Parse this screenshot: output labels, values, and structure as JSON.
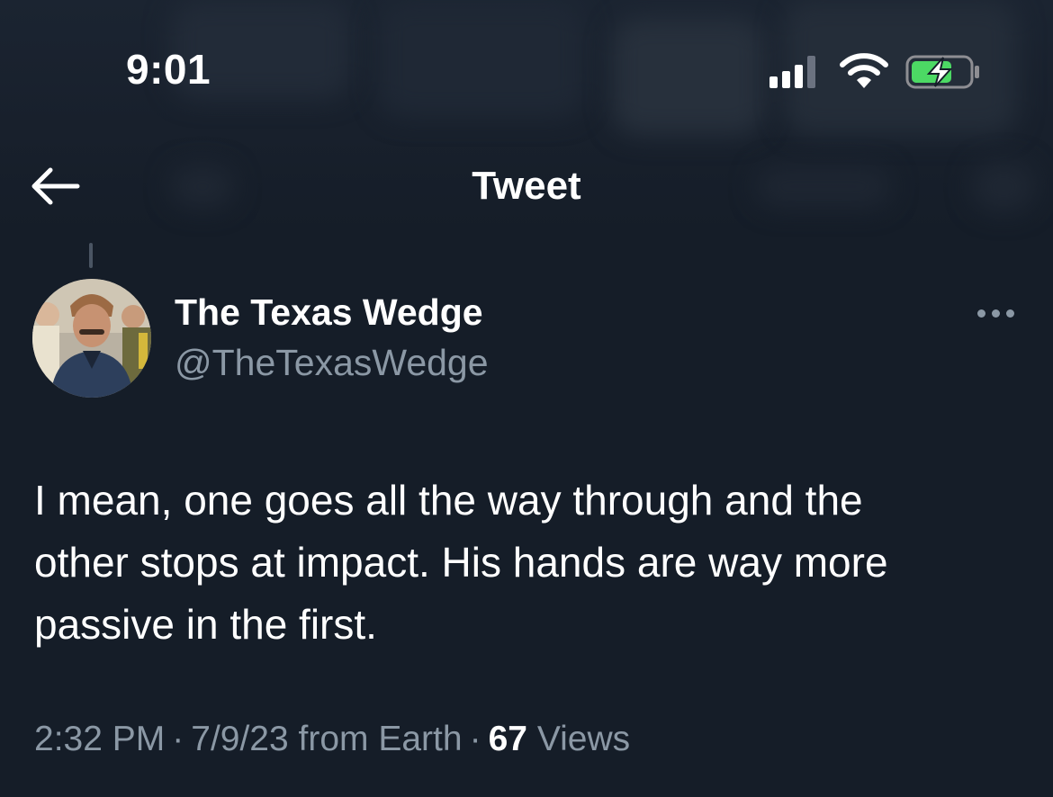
{
  "status_bar": {
    "time": "9:01",
    "signal_icon": "cellular-signal-icon",
    "wifi_icon": "wifi-icon",
    "battery_icon": "battery-charging-icon",
    "battery_color": "#4cd964"
  },
  "nav": {
    "back_icon": "arrow-left-icon",
    "title": "Tweet"
  },
  "tweet": {
    "author": {
      "display_name": "The Texas Wedge",
      "handle": "@TheTexasWedge",
      "avatar": "avatar-photo"
    },
    "more_icon": "more-horizontal-icon",
    "text_lines": [
      "I mean, one goes all the way through and the",
      "other stops at impact. His hands are way more",
      "passive in the first."
    ],
    "time": "2:32 PM",
    "separator": "·",
    "date_source": "7/9/23 from Earth",
    "views_count": "67",
    "views_label": "Views"
  },
  "colors": {
    "background": "#151d28",
    "primary_text": "#ffffff",
    "secondary_text": "#8b98a5"
  }
}
